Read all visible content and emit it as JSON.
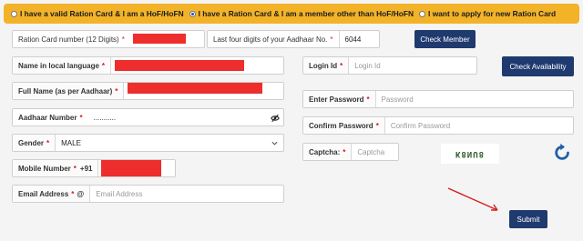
{
  "options": [
    {
      "label": "I have a valid Ration Card & I am a HoF/HoFN",
      "checked": false
    },
    {
      "label": "I have a Ration Card & I am a member other than HoF/HoFN",
      "checked": true
    },
    {
      "label": "I want to apply for new Ration Card",
      "checked": false
    }
  ],
  "ration": {
    "label": "Ration Card number (12 Digits)",
    "req": "*"
  },
  "aadhaar_last": {
    "label": "Last four digits of your Aadhaar No.",
    "req": "*",
    "value": "6044"
  },
  "check_member": "Check Member",
  "name_local": {
    "label": "Name in local language",
    "req": "*"
  },
  "full_name": {
    "label": "Full Name (as per Aadhaar)",
    "req": "*"
  },
  "aadhaar_number": {
    "label": "Aadhaar Number",
    "req": "*",
    "value": "..........."
  },
  "gender": {
    "label": "Gender",
    "req": "*",
    "value": "MALE"
  },
  "mobile": {
    "label": "Mobile Number",
    "req": "*",
    "prefix": "+91"
  },
  "email": {
    "label": "Email Address",
    "req": "*",
    "icon_char": "@",
    "placeholder": "Email Address"
  },
  "login": {
    "label": "Login Id",
    "req": "*",
    "placeholder": "Login Id"
  },
  "check_availability": "Check Availability",
  "password": {
    "label": "Enter Password",
    "req": "*",
    "placeholder": "Password"
  },
  "confirm": {
    "label": "Confirm Password",
    "req": "*",
    "placeholder": "Confirm Password"
  },
  "captcha": {
    "label": "Captcha:",
    "req": "*",
    "placeholder": "Captcha",
    "image_text": "K8NU8"
  },
  "submit": "Submit",
  "colors": {
    "topbar": "#f3b329",
    "button": "#1f3a6e",
    "redaction": "#ee2d2d",
    "refresh": "#1e5fa8",
    "arrow": "#d42020"
  },
  "icons": {
    "password_toggle": "eye-slash-icon",
    "dropdown": "chevron-down-icon",
    "refresh": "refresh-icon",
    "annotation": "arrow-icon"
  }
}
